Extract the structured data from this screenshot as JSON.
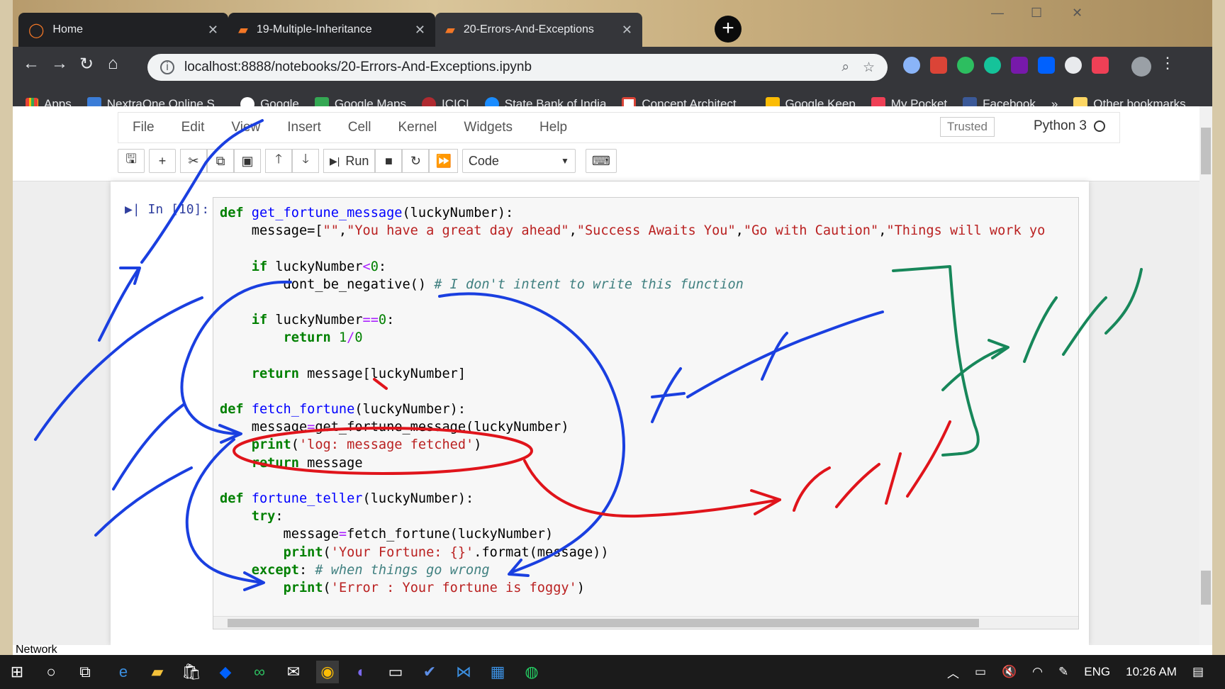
{
  "browser": {
    "tabs": [
      {
        "title": "Home",
        "icon": "jupyter-logo-icon"
      },
      {
        "title": "19-Multiple-Inheritance",
        "icon": "notebook-icon"
      },
      {
        "title": "20-Errors-And-Exceptions",
        "icon": "notebook-icon"
      }
    ],
    "url": "localhost:8888/notebooks/20-Errors-And-Exceptions.ipynb",
    "bookmarks": [
      {
        "label": "Apps",
        "icon": "apps-grid-icon"
      },
      {
        "label": "NextraOne Online S...",
        "icon": "nextraone-icon"
      },
      {
        "label": "Google",
        "icon": "google-icon"
      },
      {
        "label": "Google Maps",
        "icon": "maps-icon"
      },
      {
        "label": "ICICI",
        "icon": "icici-icon"
      },
      {
        "label": "State Bank of India",
        "icon": "sbi-icon"
      },
      {
        "label": "Concept Architect ...",
        "icon": "gmail-icon"
      },
      {
        "label": "Google Keep",
        "icon": "keep-icon"
      },
      {
        "label": "My Pocket",
        "icon": "pocket-icon"
      },
      {
        "label": "Facebook",
        "icon": "facebook-icon"
      }
    ],
    "overflow": "»",
    "other_bookmarks": "Other bookmarks"
  },
  "jupyter": {
    "menus": [
      "File",
      "Edit",
      "View",
      "Insert",
      "Cell",
      "Kernel",
      "Widgets",
      "Help"
    ],
    "trusted": "Trusted",
    "kernel": "Python 3",
    "run_label": "Run",
    "cell_type": "Code",
    "prompt": "In [10]:"
  },
  "code_lines": [
    [
      [
        "kw",
        "def "
      ],
      [
        "fn",
        "get_fortune_message"
      ],
      [
        "",
        "(luckyNumber):"
      ]
    ],
    [
      [
        "",
        "    message=["
      ],
      [
        "st",
        "\"\""
      ],
      [
        "",
        ","
      ],
      [
        "st",
        "\"You have a great day ahead\""
      ],
      [
        "",
        ","
      ],
      [
        "st",
        "\"Success Awaits You\""
      ],
      [
        "",
        ","
      ],
      [
        "st",
        "\"Go with Caution\""
      ],
      [
        "",
        ","
      ],
      [
        "st",
        "\"Things will work yo"
      ]
    ],
    [
      [
        "",
        ""
      ]
    ],
    [
      [
        "",
        "    "
      ],
      [
        "kw",
        "if "
      ],
      [
        "",
        "luckyNumber"
      ],
      [
        "op",
        "<"
      ],
      [
        "nu",
        "0"
      ],
      [
        "",
        ":"
      ]
    ],
    [
      [
        "",
        "        dont_be_negative() "
      ],
      [
        "cm",
        "# I don't intent to write this function"
      ]
    ],
    [
      [
        "",
        ""
      ]
    ],
    [
      [
        "",
        "    "
      ],
      [
        "kw",
        "if "
      ],
      [
        "",
        "luckyNumber"
      ],
      [
        "op",
        "=="
      ],
      [
        "nu",
        "0"
      ],
      [
        "",
        ":"
      ]
    ],
    [
      [
        "",
        "        "
      ],
      [
        "kw",
        "return "
      ],
      [
        "nu",
        "1"
      ],
      [
        "op",
        "/"
      ],
      [
        "nu",
        "0"
      ]
    ],
    [
      [
        "",
        ""
      ]
    ],
    [
      [
        "",
        "    "
      ],
      [
        "kw",
        "return "
      ],
      [
        "",
        "message[luckyNumber]"
      ]
    ],
    [
      [
        "",
        ""
      ]
    ],
    [
      [
        "kw",
        "def "
      ],
      [
        "fn",
        "fetch_fortune"
      ],
      [
        "",
        "(luckyNumber):"
      ]
    ],
    [
      [
        "",
        "    message"
      ],
      [
        "op",
        "="
      ],
      [
        "",
        "get_fortune_message(luckyNumber)"
      ]
    ],
    [
      [
        "",
        "    "
      ],
      [
        "kw",
        "print"
      ],
      [
        "",
        "("
      ],
      [
        "st",
        "'log: message fetched'"
      ],
      [
        "",
        ")"
      ]
    ],
    [
      [
        "",
        "    "
      ],
      [
        "kw",
        "return "
      ],
      [
        "",
        "message"
      ]
    ],
    [
      [
        "",
        ""
      ]
    ],
    [
      [
        "kw",
        "def "
      ],
      [
        "fn",
        "fortune_teller"
      ],
      [
        "",
        "(luckyNumber):"
      ]
    ],
    [
      [
        "",
        "    "
      ],
      [
        "kw",
        "try"
      ],
      [
        "",
        ":"
      ]
    ],
    [
      [
        "",
        "        message"
      ],
      [
        "op",
        "="
      ],
      [
        "",
        "fetch_fortune(luckyNumber)"
      ]
    ],
    [
      [
        "",
        "        "
      ],
      [
        "kw",
        "print"
      ],
      [
        "",
        "("
      ],
      [
        "st",
        "'Your Fortune: {}'"
      ],
      [
        "",
        ".format(message))"
      ]
    ],
    [
      [
        "",
        "    "
      ],
      [
        "kw",
        "except"
      ],
      [
        "",
        ": "
      ],
      [
        "cm",
        "# when things go wrong"
      ]
    ],
    [
      [
        "",
        "        "
      ],
      [
        "kw",
        "print"
      ],
      [
        "",
        "("
      ],
      [
        "st",
        "'Error : Your fortune is foggy'"
      ],
      [
        "",
        ")"
      ]
    ]
  ],
  "status_partial": "Network",
  "taskbar": {
    "language": "ENG",
    "time": "10:26 AM"
  },
  "colors": {
    "ink_blue": "#1a3fe0",
    "ink_red": "#e0141b",
    "ink_green": "#17875a"
  }
}
